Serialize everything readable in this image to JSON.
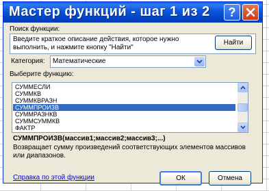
{
  "window": {
    "title": "Мастер функций - шаг 1 из 2",
    "help_glyph": "?",
    "colors": {
      "titlebar": "#0b55d8",
      "dialog_bg": "#ece9d8",
      "selection": "#316ac5"
    }
  },
  "search": {
    "label": "Поиск функции:",
    "text": "Введите краткое описание действия, которое нужно выполнить, и нажмите кнопку \"Найти\"",
    "find_button": "Найти"
  },
  "category": {
    "label": "Категория:",
    "value": "Математические"
  },
  "function_list": {
    "label": "Выберите функцию:",
    "items": [
      "СУММЕСЛИ",
      "СУММКВ",
      "СУММКВРАЗН",
      "СУММПРОИЗВ",
      "СУММРАЗНКВ",
      "СУММСУММКВ",
      "ФАКТР"
    ],
    "selected": "СУММПРОИЗВ"
  },
  "details": {
    "syntax": "СУММПРОИЗВ(массив1;массив2;массив3;...)",
    "description": "Возвращает сумму произведений соответствующих элементов массивов или диапазонов."
  },
  "footer": {
    "help_link": "Справка по этой функции",
    "ok": "ОК",
    "cancel": "Отмена"
  }
}
